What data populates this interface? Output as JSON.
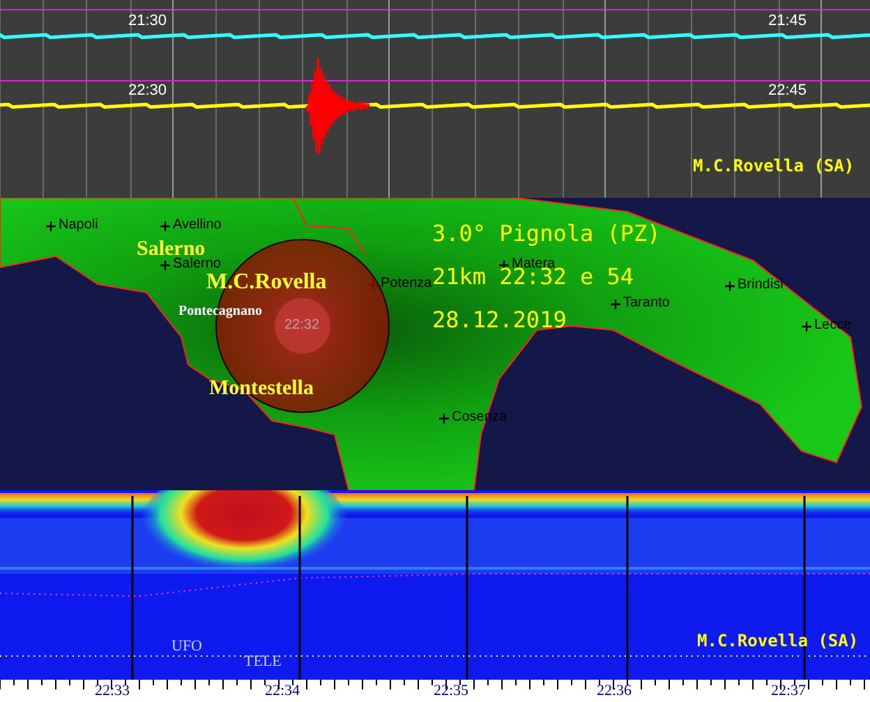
{
  "seismogram": {
    "traces": [
      {
        "kind": "quiet",
        "times": [
          "21:30",
          "21:45"
        ]
      },
      {
        "kind": "event",
        "times": [
          "22:30",
          "22:45"
        ]
      }
    ],
    "station": "M.C.Rovella (SA)"
  },
  "map": {
    "cities": [
      "Napoli",
      "Avellino",
      "Salerno",
      "Potenza",
      "Matera",
      "Taranto",
      "Brindisi",
      "Lecce",
      "Cosenza"
    ],
    "stations": [
      "Salerno",
      "M.C.Rovella",
      "Pontecagnano",
      "Montestella"
    ],
    "event": {
      "lines": [
        "3.0° Pignola (PZ)",
        "21km 22:32 e 54",
        "28.12.2019"
      ],
      "time": "22:32"
    }
  },
  "spectrogram": {
    "markers": [
      "UFO",
      "TELE"
    ],
    "station": "M.C.Rovella (SA)",
    "ticks": [
      "22:33",
      "22:34",
      "22:35",
      "22:36",
      "22:37"
    ]
  }
}
